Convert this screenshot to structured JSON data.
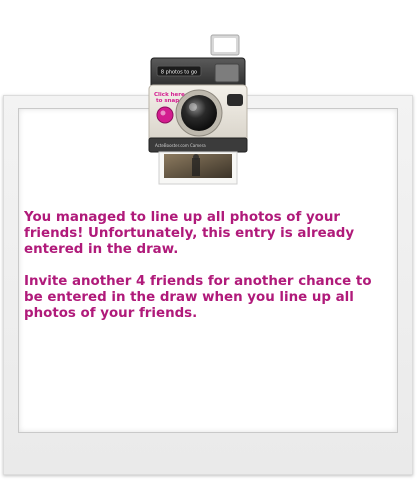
{
  "camera": {
    "top_label": "8 photos to go",
    "badge_label_line1": "Click here",
    "badge_label_line2": "to snap",
    "brand_label": "ActeBooster.com Camera"
  },
  "message": {
    "paragraph1": "You managed to line up all photos of your friends! Unfortunately, this entry is already entered in the draw.",
    "paragraph2": "Invite another 4 friends for another chance to be entered in the draw when you line up all photos of your friends."
  },
  "colors": {
    "accent": "#b01a7a"
  }
}
